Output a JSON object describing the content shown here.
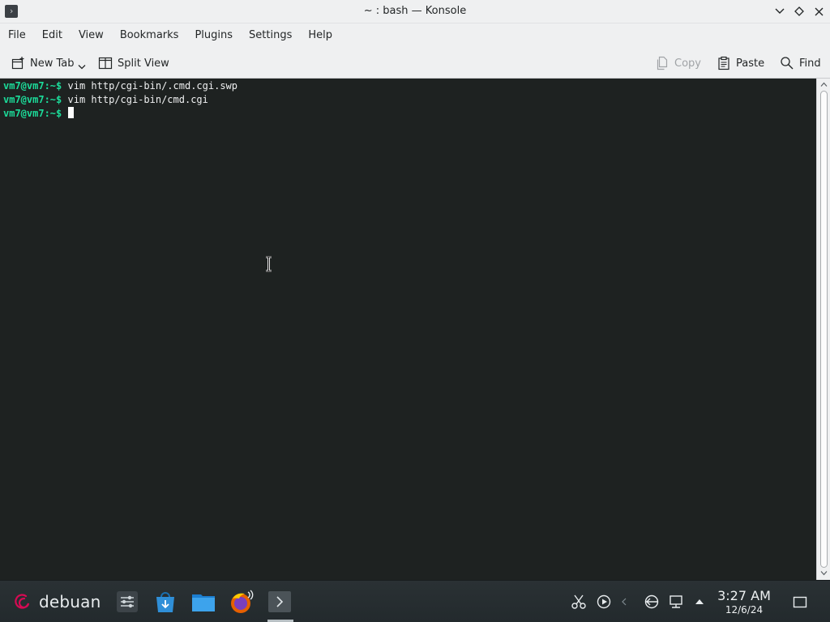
{
  "window": {
    "title": "~ : bash — Konsole"
  },
  "menubar": {
    "items": [
      "File",
      "Edit",
      "View",
      "Bookmarks",
      "Plugins",
      "Settings",
      "Help"
    ]
  },
  "toolbar": {
    "new_tab_label": "New Tab",
    "split_view_label": "Split View",
    "copy_label": "Copy",
    "paste_label": "Paste",
    "find_label": "Find"
  },
  "terminal": {
    "lines": [
      {
        "prompt": "vm7@vm7",
        "path_sep": ":~$",
        "command": " vim http/cgi-bin/.cmd.cgi.swp"
      },
      {
        "prompt": "vm7@vm7",
        "path_sep": ":~$",
        "command": " vim http/cgi-bin/cmd.cgi"
      },
      {
        "prompt": "vm7@vm7",
        "path_sep": ":~$",
        "command": " "
      }
    ],
    "prompt_color": "#1cdc9a",
    "background": "#1e2221"
  },
  "taskbar": {
    "launcher_label": "debuan",
    "apps": [
      "system-settings-icon",
      "software-center-icon",
      "file-manager-icon",
      "firefox-icon",
      "konsole-icon"
    ],
    "tray": [
      "scissors-icon",
      "media-player-icon",
      "volume-icon",
      "network-share-icon",
      "network-icon",
      "tray-expand-icon"
    ],
    "clock_time": "3:27 AM",
    "clock_date": "12/6/24"
  }
}
